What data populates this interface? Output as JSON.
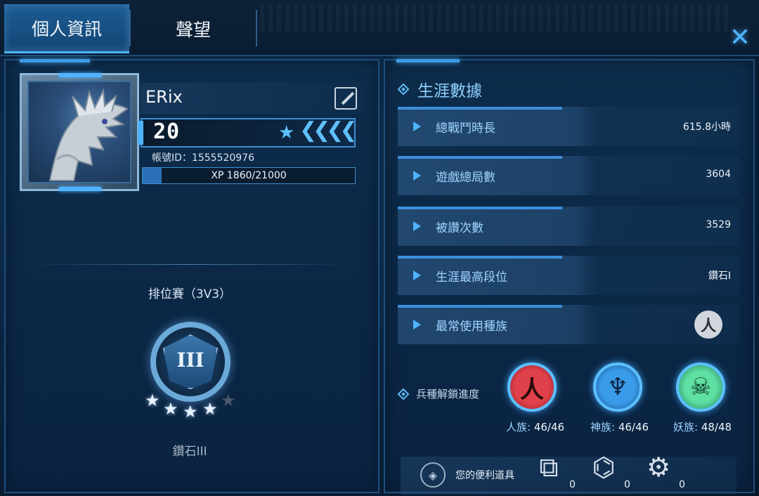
{
  "tabs": [
    {
      "label": "個人資訊",
      "active": true
    },
    {
      "label": "聲望",
      "active": false
    }
  ],
  "close_icon": "close-icon",
  "profile": {
    "name": "ERix",
    "level": "20",
    "account_id": "帳號ID：1555520976",
    "xp_text": "XP 1860/21000",
    "xp_fraction": 0.0886
  },
  "ranked": {
    "title": "排位賽（3V3）",
    "tier_roman": "III",
    "stars_filled": 4,
    "stars_total": 5,
    "rank_name": "鑽石III"
  },
  "career": {
    "title": "生涯數據",
    "stats": [
      {
        "label": "總戰鬥時長",
        "value": "615.8小時"
      },
      {
        "label": "遊戲總局數",
        "value": "3604"
      },
      {
        "label": "被讚次數",
        "value": "3529"
      },
      {
        "label": "生涯最高段位",
        "value": "鑽石I"
      },
      {
        "label": "最常使用種族",
        "value": "",
        "icon": "human-race-icon"
      }
    ]
  },
  "unlock": {
    "title": "兵種解鎖進度",
    "races": [
      {
        "label": "人族:",
        "count": "46/46",
        "color": "#e0404a"
      },
      {
        "label": "神族:",
        "count": "46/46",
        "color": "#3a9be8"
      },
      {
        "label": "妖族:",
        "count": "48/48",
        "color": "#5fe0a2"
      }
    ]
  },
  "items": {
    "label": "您的便利道具",
    "tools": [
      {
        "icon": "tool-card-icon",
        "count": "0"
      },
      {
        "icon": "tool-circuit-icon",
        "count": "0"
      },
      {
        "icon": "tool-node-icon",
        "count": "0"
      }
    ]
  }
}
